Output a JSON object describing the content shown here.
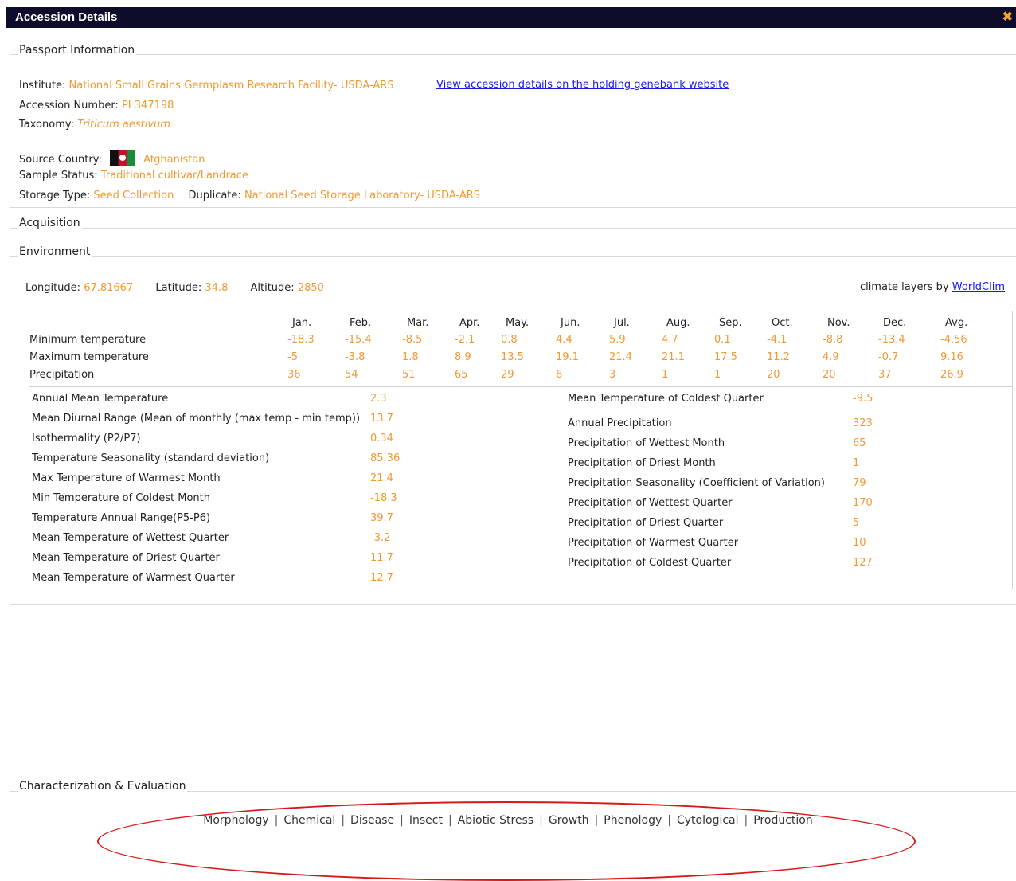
{
  "window": {
    "title": "Accession Details",
    "close_glyph": "✖"
  },
  "passport": {
    "legend": "Passport Information",
    "institute_label": "Institute:",
    "institute_value": "National Small Grains Germplasm Research Facility- USDA-ARS",
    "holding_link": "View accession details on the holding genebank website",
    "accession_label": "Accession Number:",
    "accession_value": "PI 347198",
    "taxonomy_label": "Taxonomy:",
    "taxonomy_value": "Triticum aestivum",
    "country_label": "Source Country:",
    "country_value": "Afghanistan",
    "status_label": "Sample Status:",
    "status_value": "Traditional cultivar/Landrace",
    "storage_label": "Storage Type:",
    "storage_value": "Seed Collection",
    "duplicate_label": "Duplicate:",
    "duplicate_value": "National Seed Storage Laboratory- USDA-ARS"
  },
  "acquisition": {
    "legend": "Acquisition"
  },
  "environment": {
    "legend": "Environment",
    "longitude_label": "Longitude:",
    "longitude_value": "67.81667",
    "latitude_label": "Latitude:",
    "latitude_value": "34.8",
    "altitude_label": "Altitude:",
    "altitude_value": "2850",
    "climate_prefix": "climate layers by",
    "climate_link": "WorldClim",
    "months": [
      "Jan.",
      "Feb.",
      "Mar.",
      "Apr.",
      "May.",
      "Jun.",
      "Jul.",
      "Aug.",
      "Sep.",
      "Oct.",
      "Nov.",
      "Dec.",
      "Avg."
    ],
    "rows": [
      {
        "label": "Minimum temperature",
        "values": [
          "-18.3",
          "-15.4",
          "-8.5",
          "-2.1",
          "0.8",
          "4.4",
          "5.9",
          "4.7",
          "0.1",
          "-4.1",
          "-8.8",
          "-13.4",
          "-4.56"
        ]
      },
      {
        "label": "Maximum temperature",
        "values": [
          "-5",
          "-3.8",
          "1.8",
          "8.9",
          "13.5",
          "19.1",
          "21.4",
          "21.1",
          "17.5",
          "11.2",
          "4.9",
          "-0.7",
          "9.16"
        ]
      },
      {
        "label": "Precipitation",
        "values": [
          "36",
          "54",
          "51",
          "65",
          "29",
          "6",
          "3",
          "1",
          "1",
          "20",
          "20",
          "37",
          "26.9"
        ]
      }
    ],
    "bioclim_left": [
      {
        "label": "Annual Mean Temperature",
        "value": "2.3"
      },
      {
        "label": "Mean Diurnal Range (Mean of monthly (max temp - min temp))",
        "value": "13.7"
      },
      {
        "label": "Isothermality (P2/P7)",
        "value": "0.34"
      },
      {
        "label": "Temperature Seasonality (standard deviation)",
        "value": "85.36"
      },
      {
        "label": "Max Temperature of Warmest Month",
        "value": "21.4"
      },
      {
        "label": "Min Temperature of Coldest Month",
        "value": "-18.3"
      },
      {
        "label": "Temperature Annual Range(P5-P6)",
        "value": "39.7"
      },
      {
        "label": "Mean Temperature of Wettest Quarter",
        "value": "-3.2"
      },
      {
        "label": "Mean Temperature of Driest Quarter",
        "value": "11.7"
      },
      {
        "label": "Mean Temperature of Warmest Quarter",
        "value": "12.7"
      }
    ],
    "bioclim_right": [
      {
        "label": "Mean Temperature of Coldest Quarter",
        "value": "-9.5"
      },
      {
        "label": "Annual Precipitation",
        "value": "323"
      },
      {
        "label": "Precipitation of Wettest Month",
        "value": "65"
      },
      {
        "label": "Precipitation of Driest Month",
        "value": "1"
      },
      {
        "label": "Precipitation Seasonality (Coefficient of Variation)",
        "value": "79"
      },
      {
        "label": "Precipitation of Wettest Quarter",
        "value": "170"
      },
      {
        "label": "Precipitation of Driest Quarter",
        "value": "5"
      },
      {
        "label": "Precipitation of Warmest Quarter",
        "value": "10"
      },
      {
        "label": "Precipitation of Coldest Quarter",
        "value": "127"
      }
    ]
  },
  "characterization": {
    "legend": "Characterization & Evaluation",
    "links": [
      "Morphology",
      "Chemical",
      "Disease",
      "Insect",
      "Abiotic Stress",
      "Growth",
      "Phenology",
      "Cytological",
      "Production"
    ]
  },
  "colors": {
    "titlebar": "#0d0d2b",
    "value": "#f19a35",
    "link": "#1a1aee",
    "annotation": "#d81818"
  }
}
